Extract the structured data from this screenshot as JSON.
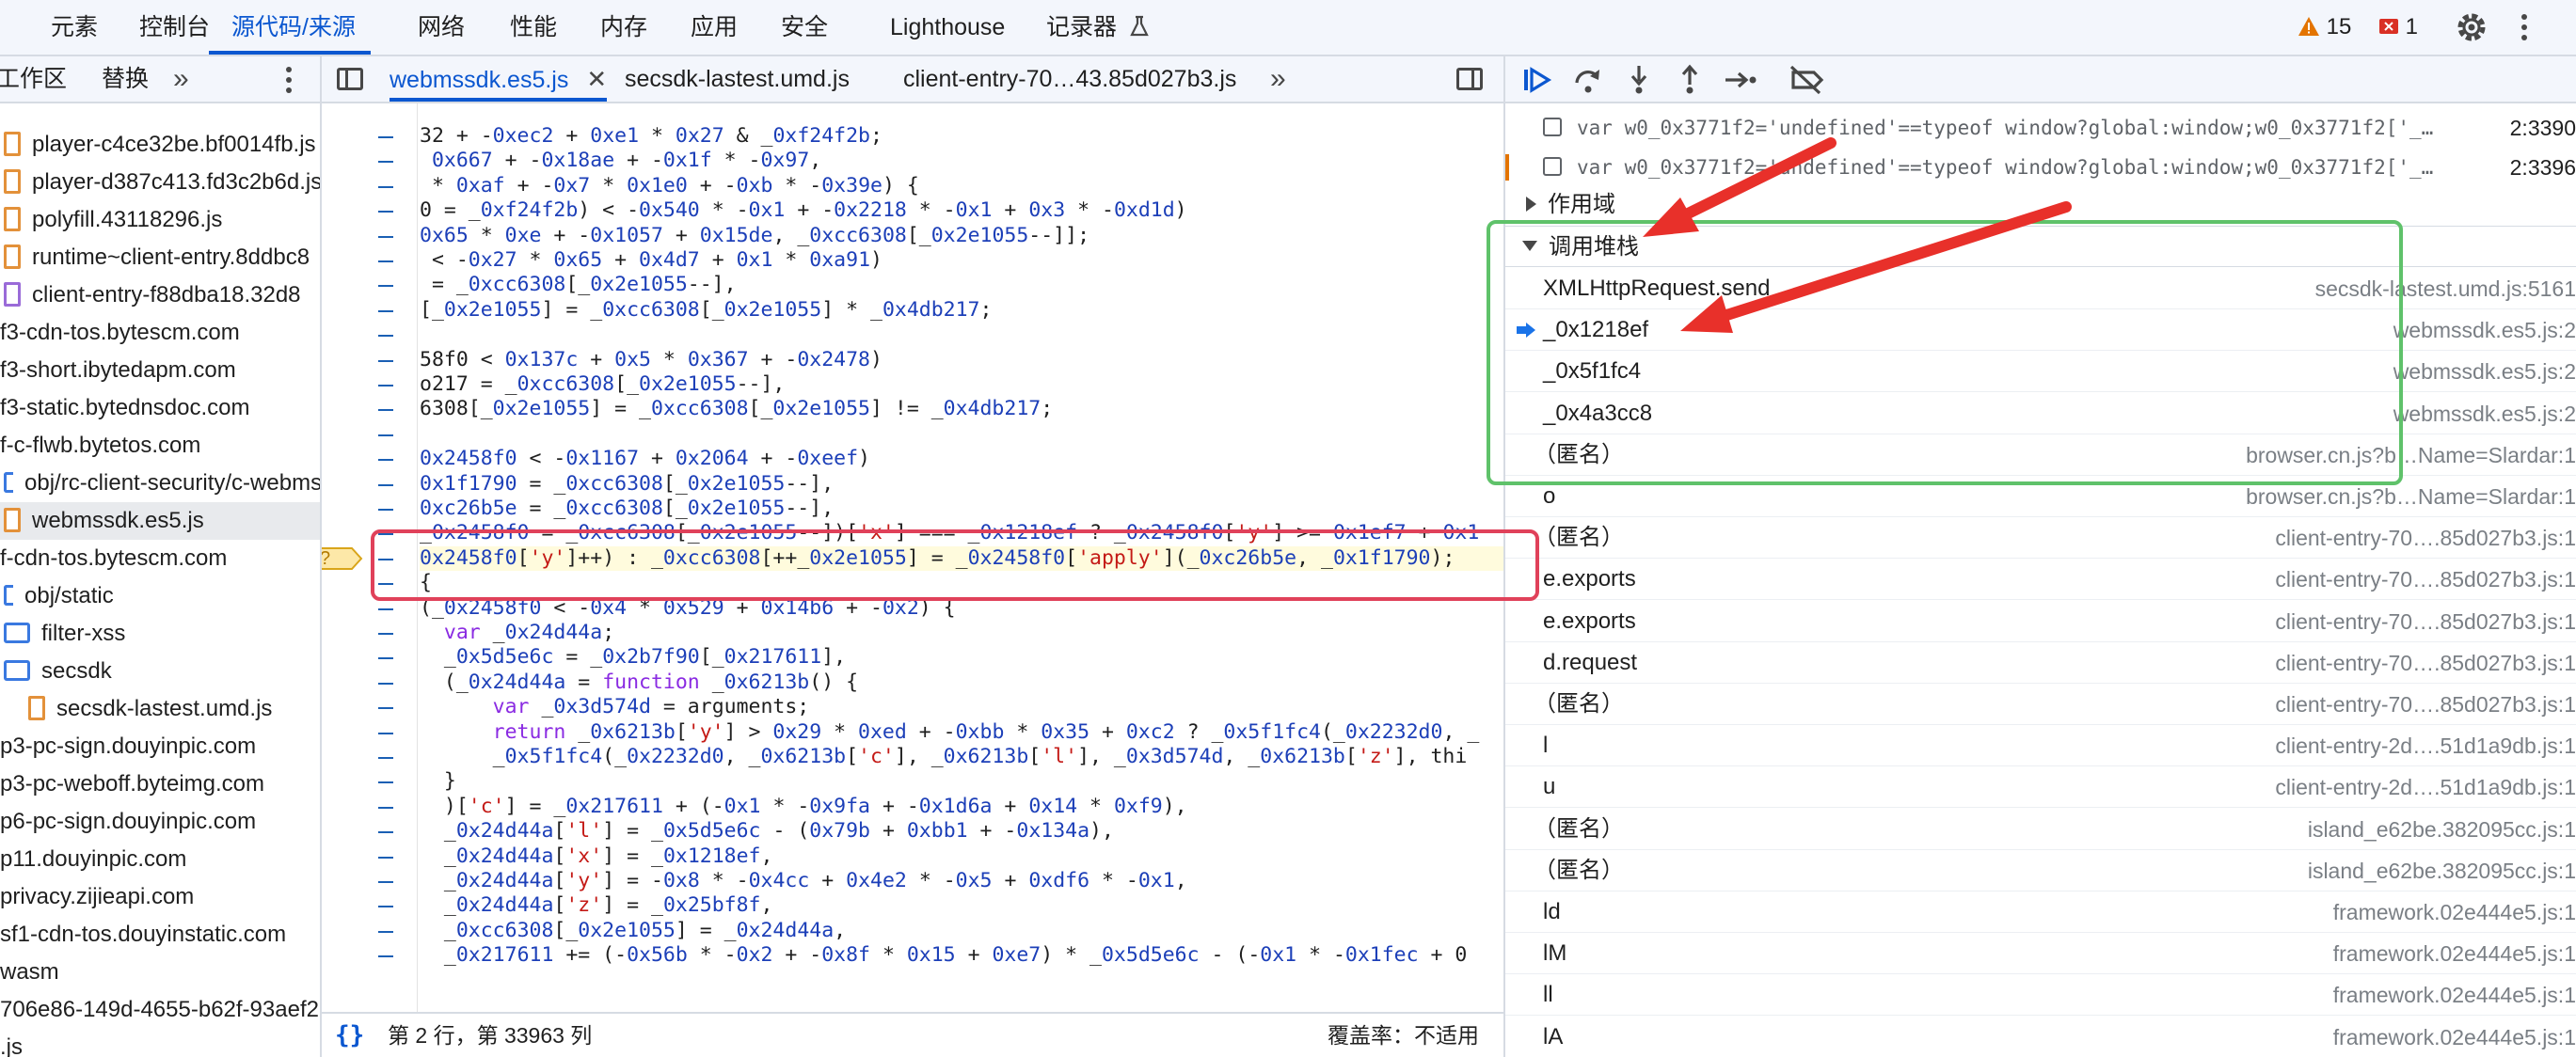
{
  "top_tabs": [
    "元素",
    "控制台",
    "源代码/来源",
    "网络",
    "性能",
    "内存",
    "应用",
    "安全",
    "Lighthouse",
    "记录器"
  ],
  "top_active": "源代码/来源",
  "issues": {
    "warnings": "15",
    "errors": "1",
    "warning_color": "#e37400",
    "error_color": "#d93025"
  },
  "navigator": {
    "tabs": [
      "工作区",
      "替换"
    ],
    "more": "»",
    "tree": [
      {
        "label": "player-c4ce32be.bf0014fb.js",
        "icon": "file",
        "indent": 1
      },
      {
        "label": "player-d387c413.fd3c2b6d.js",
        "icon": "file",
        "indent": 1
      },
      {
        "label": "polyfill.43118296.js",
        "icon": "file",
        "indent": 1
      },
      {
        "label": "runtime~client-entry.8ddbc8",
        "icon": "file",
        "indent": 1
      },
      {
        "label": "client-entry-f88dba18.32d8",
        "icon": "file-purple",
        "indent": 1
      },
      {
        "label": "f3-cdn-tos.bytescm.com",
        "icon": "none",
        "indent": 0
      },
      {
        "label": "f3-short.ibytedapm.com",
        "icon": "none",
        "indent": 0
      },
      {
        "label": "f3-static.bytednsdoc.com",
        "icon": "none",
        "indent": 0
      },
      {
        "label": "f-c-flwb.bytetos.com",
        "icon": "none",
        "indent": 0
      },
      {
        "label": "obj/rc-client-security/c-webms",
        "icon": "dir-open",
        "indent": 0
      },
      {
        "label": "webmssdk.es5.js",
        "icon": "file",
        "indent": 1,
        "selected": true
      },
      {
        "label": "f-cdn-tos.bytescm.com",
        "icon": "none",
        "indent": 0
      },
      {
        "label": "obj/static",
        "icon": "dir-open",
        "indent": 0
      },
      {
        "label": "filter-xss",
        "icon": "folder",
        "indent": 1
      },
      {
        "label": "secsdk",
        "icon": "folder",
        "indent": 1
      },
      {
        "label": "secsdk-lastest.umd.js",
        "icon": "file",
        "indent": 2
      },
      {
        "label": "p3-pc-sign.douyinpic.com",
        "icon": "none",
        "indent": 0
      },
      {
        "label": "p3-pc-weboff.byteimg.com",
        "icon": "none",
        "indent": 0
      },
      {
        "label": "p6-pc-sign.douyinpic.com",
        "icon": "none",
        "indent": 0
      },
      {
        "label": "p11.douyinpic.com",
        "icon": "none",
        "indent": 0
      },
      {
        "label": "privacy.zijieapi.com",
        "icon": "none",
        "indent": 0
      },
      {
        "label": "sf1-cdn-tos.douyinstatic.com",
        "icon": "none",
        "indent": 0
      },
      {
        "label": "wasm",
        "icon": "none",
        "indent": 0
      },
      {
        "label": "706e86-149d-4655-b62f-93aef2",
        "icon": "none",
        "indent": 0
      },
      {
        "label": ".js",
        "icon": "none",
        "indent": 0
      }
    ]
  },
  "editor": {
    "tabs": [
      "webmssdk.es5.js",
      "secsdk-lastest.umd.js",
      "client-entry-70…43.85d027b3.js"
    ],
    "active_tab": "webmssdk.es5.js",
    "more": "»",
    "code_lines": [
      "32 + -0xec2 + 0xe1 * 0x27 & _0xf24f2b;",
      " 0x667 + -0x18ae + -0x1f * -0x97,",
      " * 0xaf + -0x7 * 0x1e0 + -0xb * -0x39e) {",
      "0 = _0xf24f2b) < -0x540 * -0x1 + -0x2218 * -0x1 + 0x3 * -0xd1d)",
      "0x65 * 0xe + -0x1057 + 0x15de, _0xcc6308[_0x2e1055--]];",
      " < -0x27 * 0x65 + 0x4d7 + 0x1 * 0xa91)",
      " = _0xcc6308[_0x2e1055--],",
      "[_0x2e1055] = _0xcc6308[_0x2e1055] * _0x4db217;",
      "",
      "58f0 < 0x137c + 0x5 * 0x367 + -0x2478)",
      "o217 = _0xcc6308[_0x2e1055--],",
      "6308[_0x2e1055] = _0xcc6308[_0x2e1055] != _0x4db217;",
      "",
      "0x2458f0 < -0x1167 + 0x2064 + -0xeef)",
      "0x1f1790 = _0xcc6308[_0x2e1055--],",
      "0xc26b5e = _0xcc6308[_0x2e1055--],",
      "_0x2458f0 = _0xcc6308[_0x2e1055--])['x'] === _0x1218ef ? _0x2458f0['y'] >= 0x1ef7 + 0x1",
      "0x2458f0['y']++) : _0xcc6308[++_0x2e1055] = _0x2458f0['apply'](_0xc26b5e, _0x1f1790);",
      "{",
      "(_0x2458f0 < -0x4 * 0x529 + 0x14b6 + -0x2) {",
      "  var _0x24d44a;",
      "  _0x5d5e6c = _0x2b7f90[_0x217611],",
      "  (_0x24d44a = function _0x6213b() {",
      "      var _0x3d574d = arguments;",
      "      return _0x6213b['y'] > 0x29 * 0xed + -0xbb * 0x35 + 0xc2 ? _0x5f1fc4(_0x2232d0, _",
      "      _0x5f1fc4(_0x2232d0, _0x6213b['c'], _0x6213b['l'], _0x3d574d, _0x6213b['z'], thi",
      "  }",
      "  )['c'] = _0x217611 + (-0x1 * -0x9fa + -0x1d6a + 0x14 * 0xf9),",
      "  _0x24d44a['l'] = _0x5d5e6c - (0x79b + 0xbb1 + -0x134a),",
      "  _0x24d44a['x'] = _0x1218ef,",
      "  _0x24d44a['y'] = -0x8 * -0x4cc + 0x4e2 * -0x5 + 0xdf6 * -0x1,",
      "  _0x24d44a['z'] = _0x25bf8f,",
      "  _0xcc6308[_0x2e1055] = _0x24d44a,",
      "  _0x217611 += (-0x56b * -0x2 + -0x8f * 0x15 + 0xe7) * _0x5d5e6c - (-0x1 * -0x1fec + 0"
    ],
    "paused_line_index": 17,
    "breakpoint_marker": "?"
  },
  "status": {
    "position": "第 2 行，第 33963 列",
    "coverage": "覆盖率：不适用",
    "pretty_icon": "{}"
  },
  "debugger": {
    "breakpoints": [
      {
        "code": "var w0_0x3771f2='undefined'==typeof window?global:window;w0_0x3771f2['_…",
        "line": "2:3390"
      },
      {
        "code": "var w0_0x3771f2='undefined'==typeof window?global:window;w0_0x3771f2['_…",
        "line": "2:3396"
      }
    ],
    "scope_label": "作用域",
    "callstack_label": "调用堆栈",
    "frames": [
      {
        "name": "XMLHttpRequest.send",
        "loc": "secsdk-lastest.umd.js:5161"
      },
      {
        "name": "_0x1218ef",
        "loc": "webmssdk.es5.js:2",
        "current": true
      },
      {
        "name": "_0x5f1fc4",
        "loc": "webmssdk.es5.js:2"
      },
      {
        "name": "_0x4a3cc8",
        "loc": "webmssdk.es5.js:2"
      },
      {
        "name": "（匿名）",
        "loc": "browser.cn.js?b…Name=Slardar:1"
      },
      {
        "name": "o",
        "loc": "browser.cn.js?b…Name=Slardar:1"
      },
      {
        "name": "（匿名）",
        "loc": "client-entry-70….85d027b3.js:1"
      },
      {
        "name": "e.exports",
        "loc": "client-entry-70….85d027b3.js:1"
      },
      {
        "name": "e.exports",
        "loc": "client-entry-70….85d027b3.js:1"
      },
      {
        "name": "d.request",
        "loc": "client-entry-70….85d027b3.js:1"
      },
      {
        "name": "（匿名）",
        "loc": "client-entry-70….85d027b3.js:1"
      },
      {
        "name": "l",
        "loc": "client-entry-2d….51d1a9db.js:1"
      },
      {
        "name": "u",
        "loc": "client-entry-2d….51d1a9db.js:1"
      },
      {
        "name": "（匿名）",
        "loc": "island_e62be.382095cc.js:1"
      },
      {
        "name": "（匿名）",
        "loc": "island_e62be.382095cc.js:1"
      },
      {
        "name": "ld",
        "loc": "framework.02e444e5.js:1"
      },
      {
        "name": "lM",
        "loc": "framework.02e444e5.js:1"
      },
      {
        "name": "ll",
        "loc": "framework.02e444e5.js:1"
      },
      {
        "name": "lA",
        "loc": "framework.02e444e5.js:1"
      }
    ]
  },
  "colors": {
    "accent": "#0b57d0",
    "annotation_red": "#e0415a",
    "annotation_green": "#5fc26a",
    "arrow_red": "#e8302a"
  }
}
